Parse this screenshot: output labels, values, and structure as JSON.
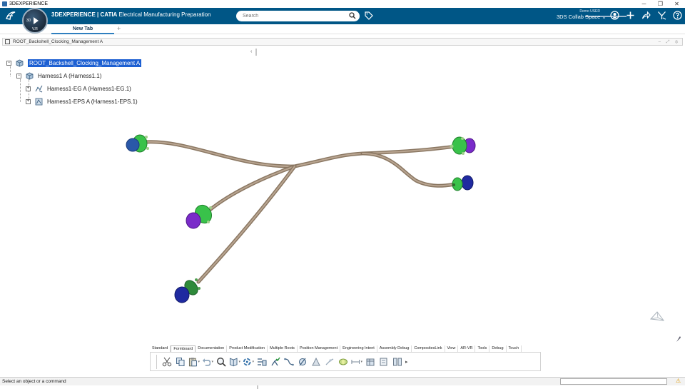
{
  "window": {
    "title": "3DEXPERIENCE",
    "controls": [
      "─",
      "❐",
      "✕"
    ]
  },
  "topbar": {
    "compass_3d": "3D",
    "compass_version": "V.R",
    "brand_strong": "3DEXPERIENCE | CATIA",
    "brand_app": " Electrical Manufacturing Preparation",
    "search_placeholder": "Search",
    "user_name": "Demo USER",
    "collab_space": "3DS Collab Space ⌄",
    "accent_color": "#005686"
  },
  "tabs": {
    "active": "New Tab",
    "add": "+"
  },
  "document": {
    "title": "ROOT_Backshell_Clocking_Management A",
    "controls": "– ⤢ ⊗"
  },
  "tree": {
    "root": "ROOT_Backshell_Clocking_Management A",
    "harness": "Harness1 A (Harness1.1)",
    "eg": "Harness1-EG A (Harness1-EG.1)",
    "eps": "Harness1-EPS A (Harness1-EPS.1)",
    "collapse": "‹"
  },
  "action_bar": {
    "tabs": [
      "Standard",
      "Formboard",
      "Documentation",
      "Product Modification",
      "Multiple Roots",
      "Position Management",
      "Engineering Intent",
      "Assembly Debug",
      "CompositesLink",
      "View",
      "AR-VR",
      "Tools",
      "Debug",
      "Touch"
    ],
    "active_tab_index": 1,
    "more": "▸"
  },
  "status": {
    "message": "Select an object or a command",
    "warn": "⚠"
  }
}
